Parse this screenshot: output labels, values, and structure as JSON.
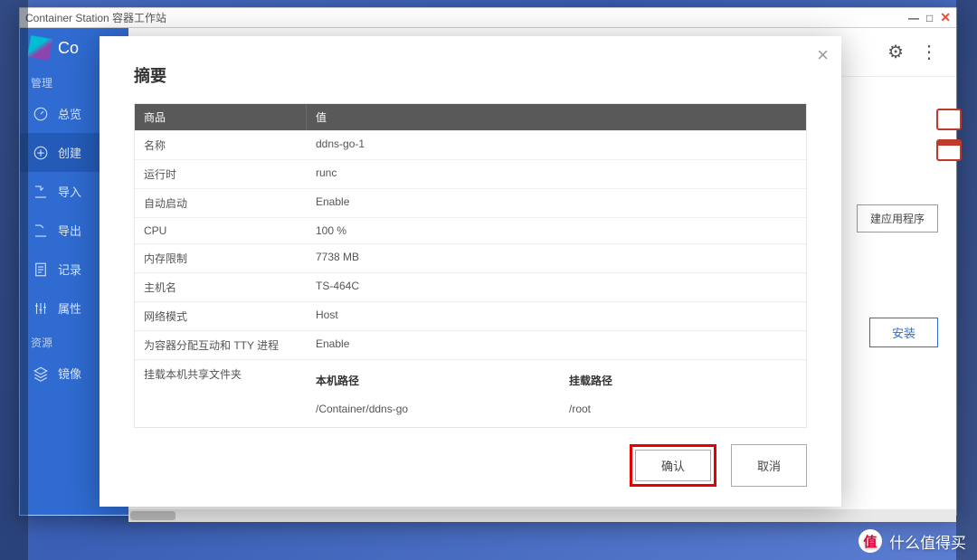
{
  "window": {
    "title": "Container Station 容器工作站"
  },
  "sidebar": {
    "brand_short": "Co",
    "section_manage": "管理",
    "section_resource": "资源",
    "items": [
      {
        "label": "总览"
      },
      {
        "label": "创建"
      },
      {
        "label": "导入"
      },
      {
        "label": "导出"
      },
      {
        "label": "记录"
      },
      {
        "label": "属性"
      },
      {
        "label": "镜像"
      }
    ]
  },
  "behind": {
    "create_app": "建应用程序",
    "install": "安装"
  },
  "modal": {
    "title": "摘要",
    "header_key": "商品",
    "header_value": "值",
    "rows": [
      {
        "k": "名称",
        "v": "ddns-go-1"
      },
      {
        "k": "运行时",
        "v": "runc"
      },
      {
        "k": "自动启动",
        "v": "Enable"
      },
      {
        "k": "CPU",
        "v": "100 %"
      },
      {
        "k": "内存限制",
        "v": "7738 MB"
      },
      {
        "k": "主机名",
        "v": "TS-464C"
      },
      {
        "k": "网络模式",
        "v": "Host"
      },
      {
        "k": "为容器分配互动和 TTY 进程",
        "v": "Enable"
      }
    ],
    "mount_label": "挂载本机共享文件夹",
    "mount_host_header": "本机路径",
    "mount_target_header": "挂载路径",
    "mount_host_value": "/Container/ddns-go",
    "mount_target_value": "/root",
    "confirm": "确认",
    "cancel": "取消"
  },
  "watermark": "什么值得买",
  "watermark_badge": "值"
}
